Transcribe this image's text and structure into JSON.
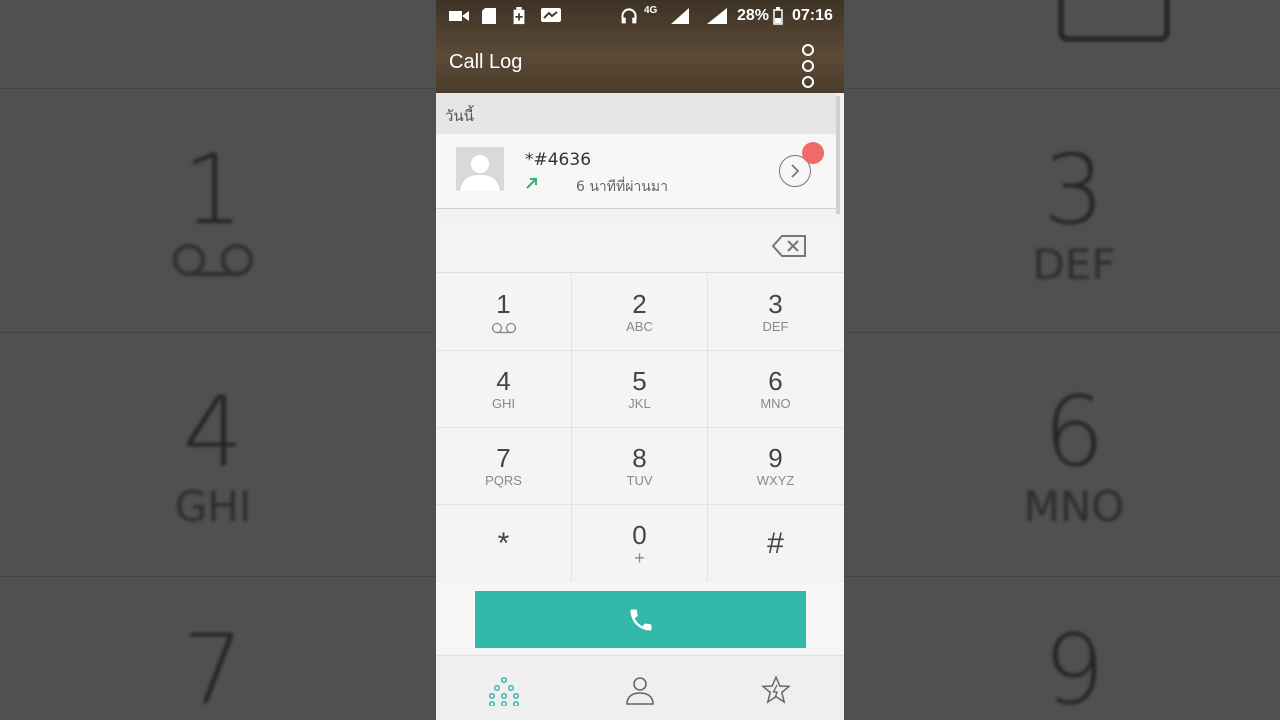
{
  "status": {
    "battery": "28%",
    "time": "07:16",
    "network": "4G"
  },
  "header": {
    "title": "Call Log"
  },
  "section": {
    "label": "วันนี้"
  },
  "call_log": [
    {
      "number": "*#4636",
      "time_ago": "6 นาทีที่ผ่านมา"
    }
  ],
  "keypad": [
    {
      "digit": "1",
      "letters": ""
    },
    {
      "digit": "2",
      "letters": "ABC"
    },
    {
      "digit": "3",
      "letters": "DEF"
    },
    {
      "digit": "4",
      "letters": "GHI"
    },
    {
      "digit": "5",
      "letters": "JKL"
    },
    {
      "digit": "6",
      "letters": "MNO"
    },
    {
      "digit": "7",
      "letters": "PQRS"
    },
    {
      "digit": "8",
      "letters": "TUV"
    },
    {
      "digit": "9",
      "letters": "WXYZ"
    },
    {
      "digit": "*",
      "letters": ""
    },
    {
      "digit": "0",
      "letters": "+"
    },
    {
      "digit": "#",
      "letters": ""
    }
  ],
  "background": {
    "left_keys": [
      {
        "digit": "1"
      },
      {
        "digit": "4",
        "letters": "GHI"
      },
      {
        "digit": "7"
      }
    ],
    "right_keys": [
      {
        "digit": "3",
        "letters": "DEF"
      },
      {
        "digit": "6",
        "letters": "MNO"
      },
      {
        "digit": "9"
      }
    ]
  },
  "colors": {
    "accent": "#33b9aa",
    "badge": "#f06a6a",
    "outgoing_arrow": "#2fb36b"
  }
}
